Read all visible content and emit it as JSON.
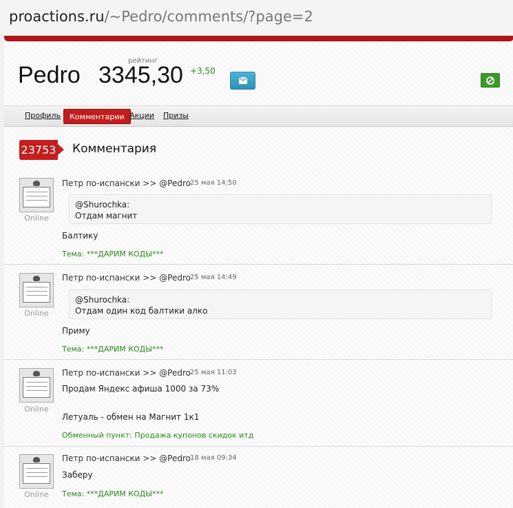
{
  "browser": {
    "domain": "proactions.ru",
    "path": "/~Pedro/comments/?page=2"
  },
  "profile": {
    "username": "Pedro",
    "rating_label": "рейтинг",
    "rating_value": "3345,30",
    "rating_delta": "+3,50",
    "mail_icon": "envelope-icon",
    "ban_icon": "block-icon",
    "colors": {
      "accent": "#c21d1d",
      "positive": "#2a8a1a",
      "mail": "#3ba3cc",
      "ban": "#3b9a2a"
    }
  },
  "tabs": [
    {
      "label": "Профиль",
      "active": false
    },
    {
      "label": "Комментарии",
      "active": true
    },
    {
      "label": "Акции",
      "active": false
    },
    {
      "label": "Призы",
      "active": false
    }
  ],
  "comments_header": {
    "count": "23753",
    "label": "Комментария"
  },
  "comments": [
    {
      "author": "Петр по-испански >> @Pedro",
      "date": "25 мая 14:50",
      "status": "Online",
      "quote_author": "@Shurochka:",
      "quote_text": "Отдам магнит",
      "text": "Балтику",
      "topic_prefix": "Тема:",
      "topic": "***ДАРИМ КОДЫ***"
    },
    {
      "author": "Петр по-испански >> @Pedro",
      "date": "25 мая 14:49",
      "status": "Online",
      "quote_author": "@Shurochka:",
      "quote_text": "Отдам один код балтики алко",
      "text": "Приму",
      "topic_prefix": "Тема:",
      "topic": "***ДАРИМ КОДЫ***"
    },
    {
      "author": "Петр по-испански >> @Pedro",
      "date": "25 мая 11:03",
      "status": "Online",
      "text": "Продам Яндекс афиша 1000 за 73%",
      "text2": "Летуаль - обмен на Магнит 1к1",
      "topic_prefix": "Обменный пункт:",
      "topic": "Продажа купонов скидок итд"
    },
    {
      "author": "Петр по-испански >> @Pedro",
      "date": "18 мая 09:34",
      "status": "Online",
      "text": "Заберу",
      "topic_prefix": "Тема:",
      "topic": "***ДАРИМ КОДЫ***"
    }
  ]
}
